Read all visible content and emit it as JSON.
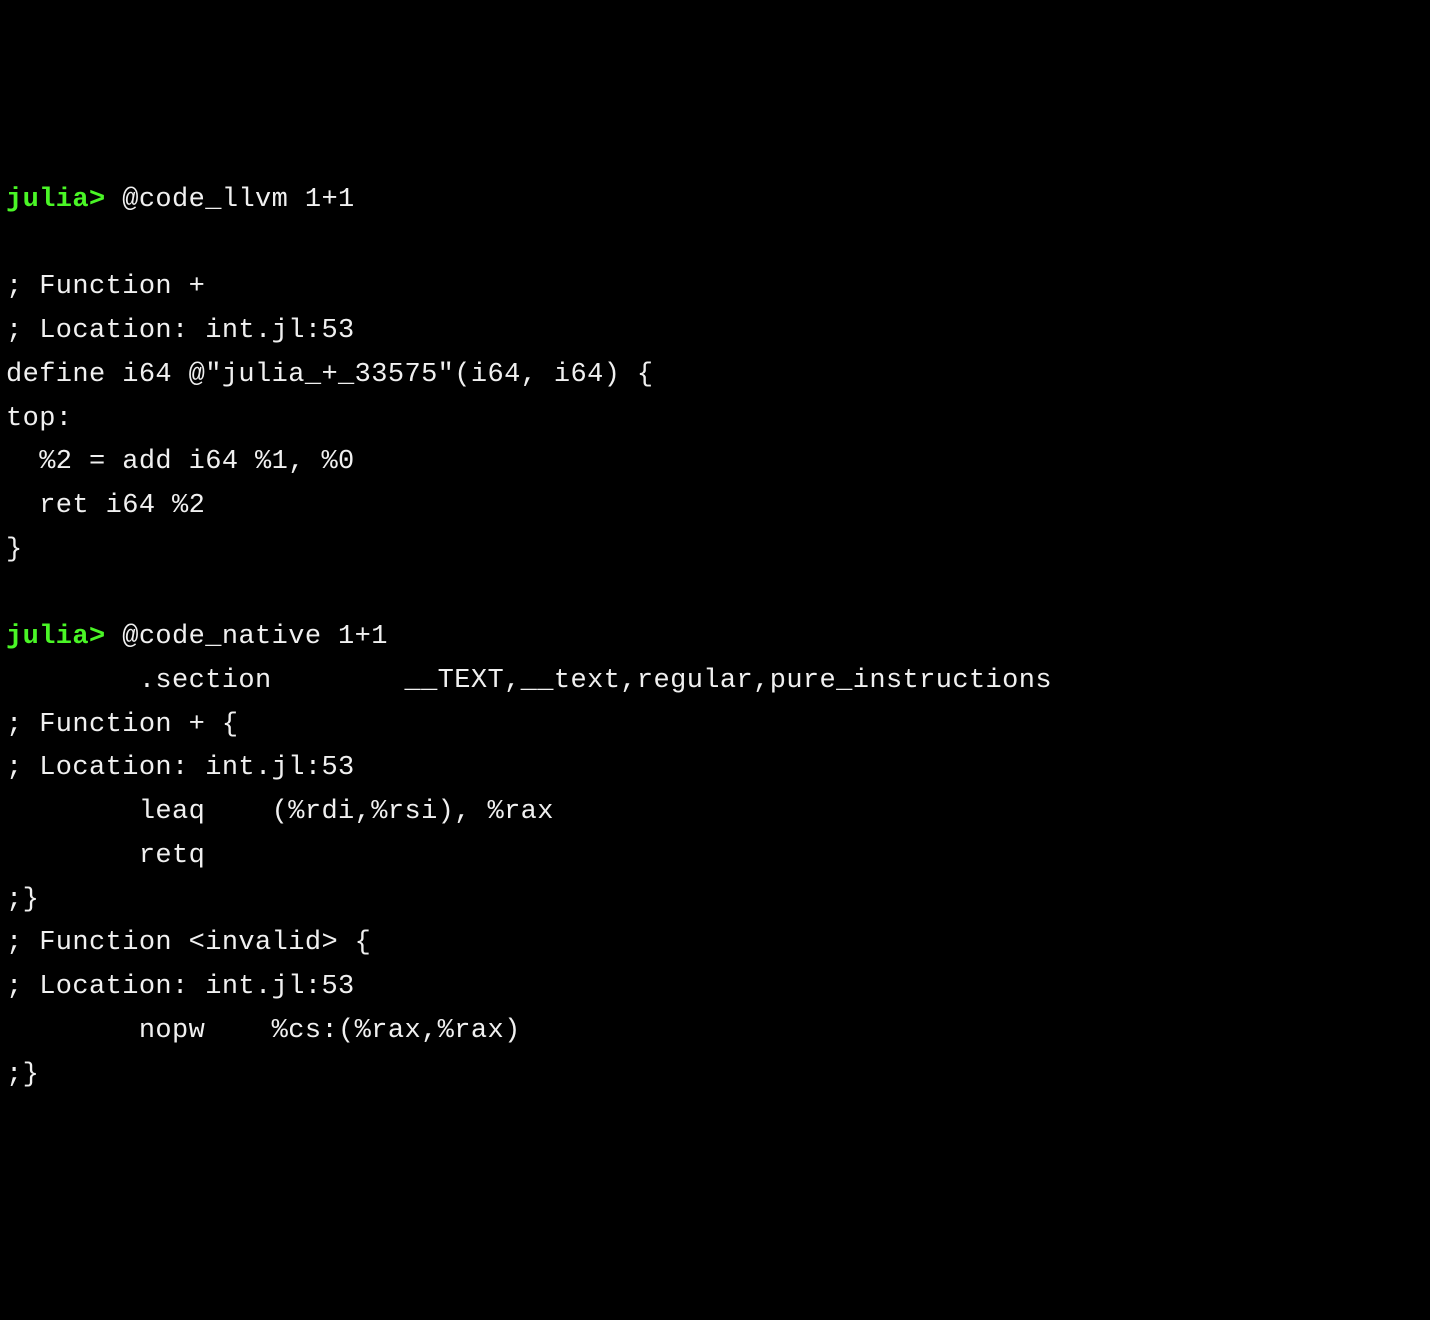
{
  "terminal": {
    "sessions": [
      {
        "prompt": "julia>",
        "command": " @code_llvm 1+1",
        "output": "\n; Function +\n; Location: int.jl:53\ndefine i64 @\"julia_+_33575\"(i64, i64) {\ntop:\n  %2 = add i64 %1, %0\n  ret i64 %2\n}\n"
      },
      {
        "prompt": "julia>",
        "command": " @code_native 1+1",
        "output": "        .section        __TEXT,__text,regular,pure_instructions\n; Function + {\n; Location: int.jl:53\n        leaq    (%rdi,%rsi), %rax\n        retq\n;}\n; Function <invalid> {\n; Location: int.jl:53\n        nopw    %cs:(%rax,%rax)\n;}"
      }
    ]
  }
}
